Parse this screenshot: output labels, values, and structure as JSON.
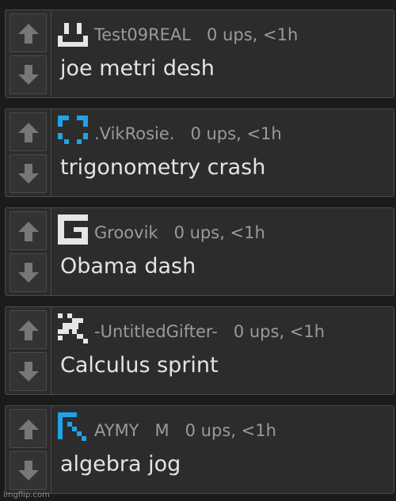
{
  "comments": [
    {
      "username": "Test09REAL",
      "stats": "0 ups, <1h",
      "text": "joe metri desh",
      "avatar_icon": "smiley-face-icon",
      "avatar_color": "#e6e6e6"
    },
    {
      "username": ".VikRosie.",
      "stats": "0 ups, <1h",
      "text": "trigonometry crash",
      "avatar_icon": "dotted-frame-icon",
      "avatar_color": "#1fa3e6"
    },
    {
      "username": "Groovik",
      "stats": "0 ups, <1h",
      "text": "Obama dash",
      "avatar_icon": "g-logo-icon",
      "avatar_color": "#e6e6e6"
    },
    {
      "username": "-UntitledGifter-",
      "stats": "0 ups, <1h",
      "text": "Calculus sprint",
      "avatar_icon": "pixel-scatter-icon",
      "avatar_color": "#e6e6e6"
    },
    {
      "username": "AYMY",
      "badge": "M",
      "stats": "0 ups, <1h",
      "text": "algebra jog",
      "avatar_icon": "pixel-arrow-icon",
      "avatar_color": "#1fa3e6"
    }
  ],
  "icons": {
    "upvote": "arrow-up-icon",
    "downvote": "arrow-down-icon"
  },
  "watermark": "imgflip.com"
}
